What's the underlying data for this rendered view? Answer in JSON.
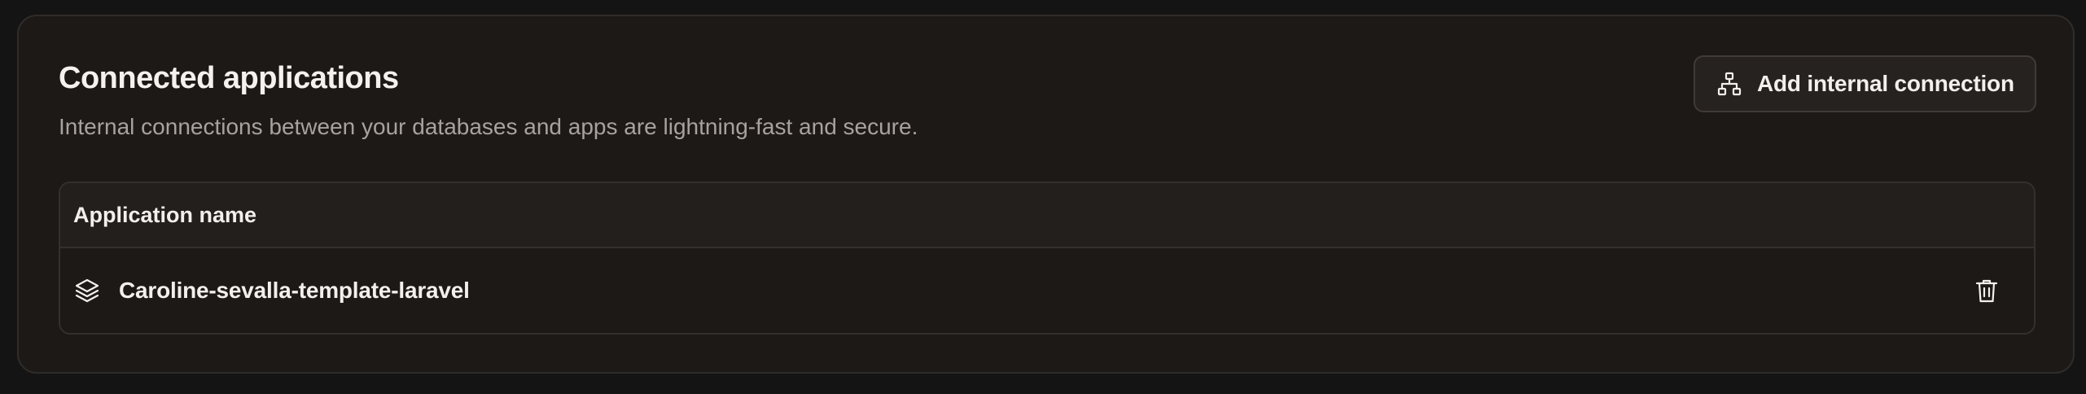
{
  "section": {
    "title": "Connected applications",
    "subtitle": "Internal connections between your databases and apps are lightning-fast and secure."
  },
  "add_button": {
    "label": "Add internal connection",
    "icon": "network-hierarchy-icon"
  },
  "table": {
    "columns": [
      "Application name"
    ],
    "rows": [
      {
        "name": "Caroline-sevalla-template-laravel",
        "icon": "layers-icon",
        "action_icon": "trash-icon"
      }
    ]
  },
  "colors": {
    "background": "#141414",
    "card": "#1c1917",
    "border": "#2f2c2a",
    "text_primary": "#f2efec",
    "text_secondary": "#a8a29e"
  }
}
